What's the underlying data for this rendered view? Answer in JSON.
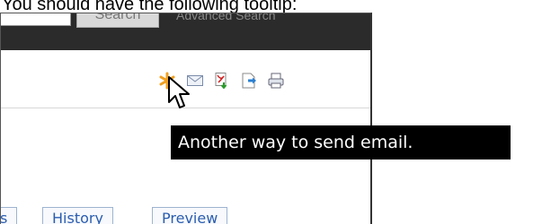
{
  "caption": "You should have the following tooltip:",
  "header": {
    "search_button": "Search",
    "advanced_search": "Advanced Search"
  },
  "toolbar": {
    "icons": [
      "sendto-icon",
      "email-icon",
      "pdf-icon",
      "export-icon",
      "print-icon"
    ]
  },
  "tooltip": {
    "text": "Another way to send email."
  },
  "tabs": {
    "first_partial": "s",
    "history": "History",
    "preview": "Preview"
  }
}
